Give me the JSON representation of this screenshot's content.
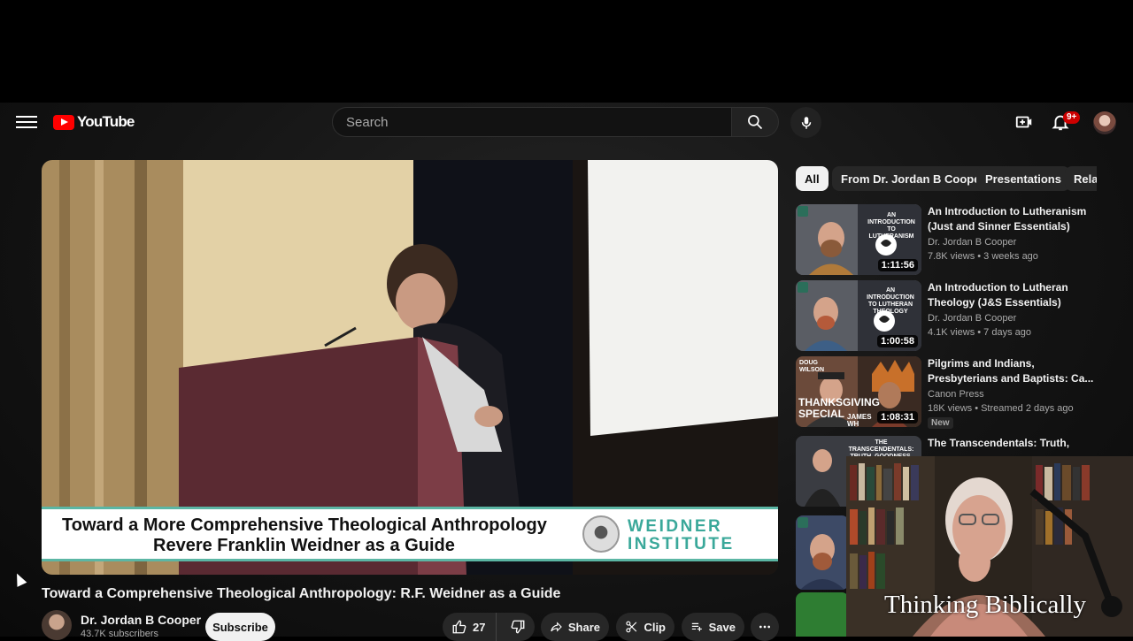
{
  "header": {
    "logo_text": "YouTube",
    "search_placeholder": "Search",
    "notification_count": "9+",
    "icons": [
      "menu-icon",
      "youtube-logo-icon",
      "search-icon",
      "mic-icon",
      "create-icon",
      "bell-icon",
      "avatar"
    ]
  },
  "video": {
    "banner_line1": "Toward a More Comprehensive Theological Anthropology",
    "banner_line2": "Revere Franklin Weidner as a Guide",
    "banner_institute_line1": "WEIDNER",
    "banner_institute_line2": "INSTITUTE",
    "title": "Toward a Comprehensive Theological Anthropology: R.F. Weidner as a Guide",
    "channel_name": "Dr. Jordan B Cooper",
    "subscribers": "43.7K subscribers",
    "subscribe_label": "Subscribe",
    "like_count": "27",
    "share_label": "Share",
    "clip_label": "Clip",
    "save_label": "Save"
  },
  "chips": [
    "All",
    "From Dr. Jordan B Cooper",
    "Presentations",
    "Related"
  ],
  "recommendations": [
    {
      "title": "An Introduction to Lutheranism (Just and Sinner Essentials)",
      "channel": "Dr. Jordan B Cooper",
      "meta": "7.8K views • 3 weeks ago",
      "duration": "1:11:56",
      "thumb_text": "AN INTRODUCTION TO LUTHERANISM"
    },
    {
      "title": "An Introduction to Lutheran Theology (J&S Essentials)",
      "channel": "Dr. Jordan B Cooper",
      "meta": "4.1K views • 7 days ago",
      "duration": "1:00:58",
      "thumb_text": "AN INTRODUCTION TO LUTHERAN THEOLOGY"
    },
    {
      "title": "Pilgrims and Indians, Presbyterians and Baptists: Ca...",
      "channel": "Canon Press",
      "meta": "18K views • Streamed 2 days ago",
      "duration": "1:08:31",
      "badge": "New",
      "thumb_text": "DOUG WILSON",
      "thumb_text2": "THANKSGIVING SPECIAL",
      "thumb_text3": "JAMES WH"
    },
    {
      "title": "The Transcendentals: Truth,",
      "thumb_text": "THE TRANSCENDENTALS: TRUTH, GOODNESS,"
    }
  ],
  "overlay": {
    "label": "Thinking Biblically"
  },
  "colors": {
    "accent_red": "#ff0000",
    "institute_teal": "#3aa89a",
    "chip_bg": "#272727"
  }
}
